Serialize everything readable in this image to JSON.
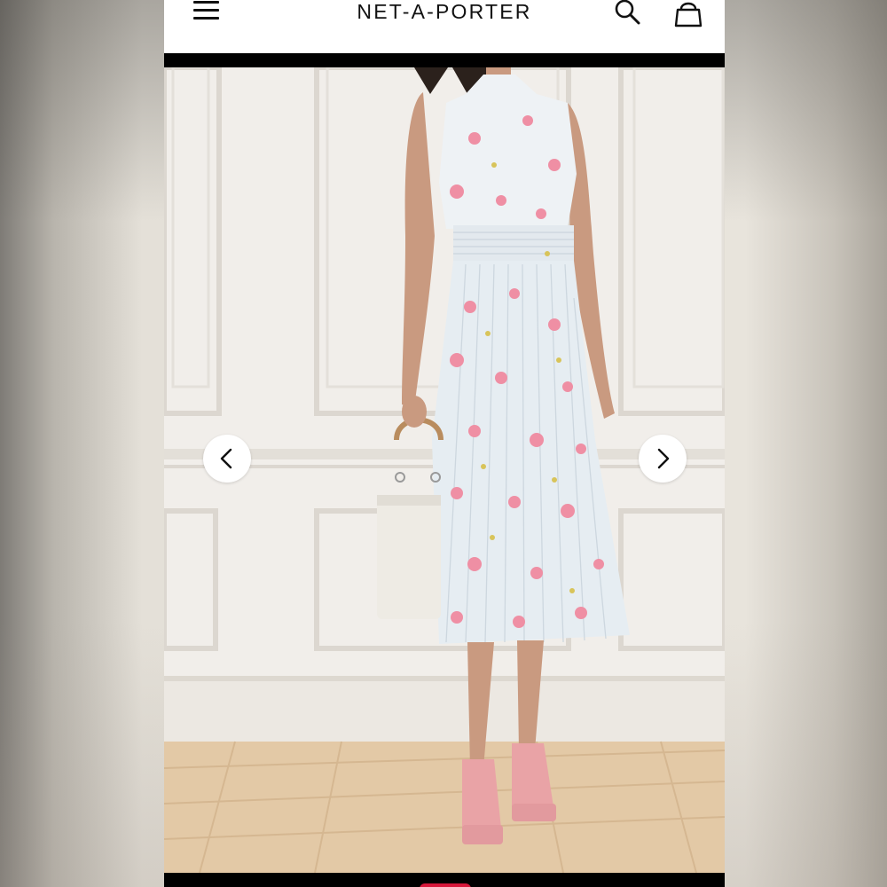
{
  "header": {
    "brand": "NET-A-PORTER",
    "menu_icon": "hamburger-menu-icon",
    "search_icon": "search-icon",
    "bag_icon": "shopping-bag-icon"
  },
  "gallery": {
    "prev_icon": "chevron-left-icon",
    "next_icon": "chevron-right-icon",
    "active_indicator_color": "#d6173a"
  },
  "colors": {
    "header_bg": "#ffffff",
    "frame_bg": "#000000",
    "brand_text": "#111111"
  }
}
